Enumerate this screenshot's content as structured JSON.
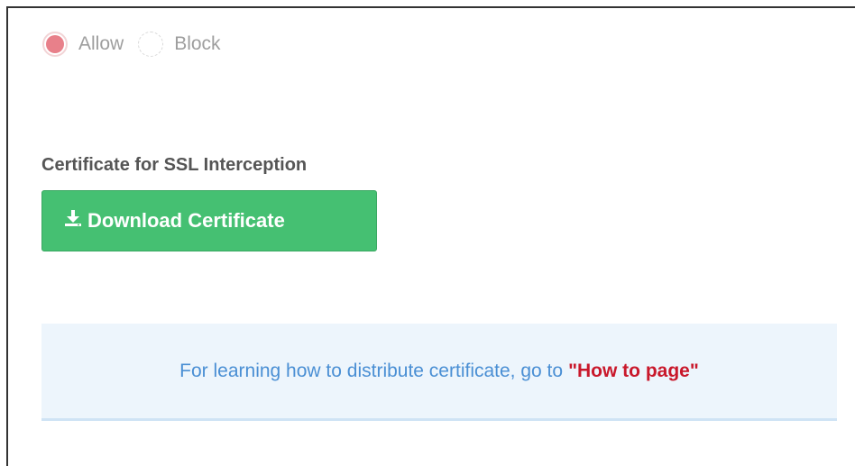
{
  "access": {
    "options": [
      {
        "label": "Allow",
        "selected": true
      },
      {
        "label": "Block",
        "selected": false
      }
    ]
  },
  "certificate": {
    "section_label": "Certificate for SSL Interception",
    "download_label": "Download Certificate",
    "download_icon": "download-icon"
  },
  "info": {
    "text": "For learning how to distribute certificate, go to",
    "link_text": "\"How to page\""
  },
  "colors": {
    "accent_radio": "#e8808a",
    "button_green": "#45c072",
    "info_bg": "#edf5fc",
    "info_text": "#4a8fd4",
    "link_red": "#c9182b"
  }
}
